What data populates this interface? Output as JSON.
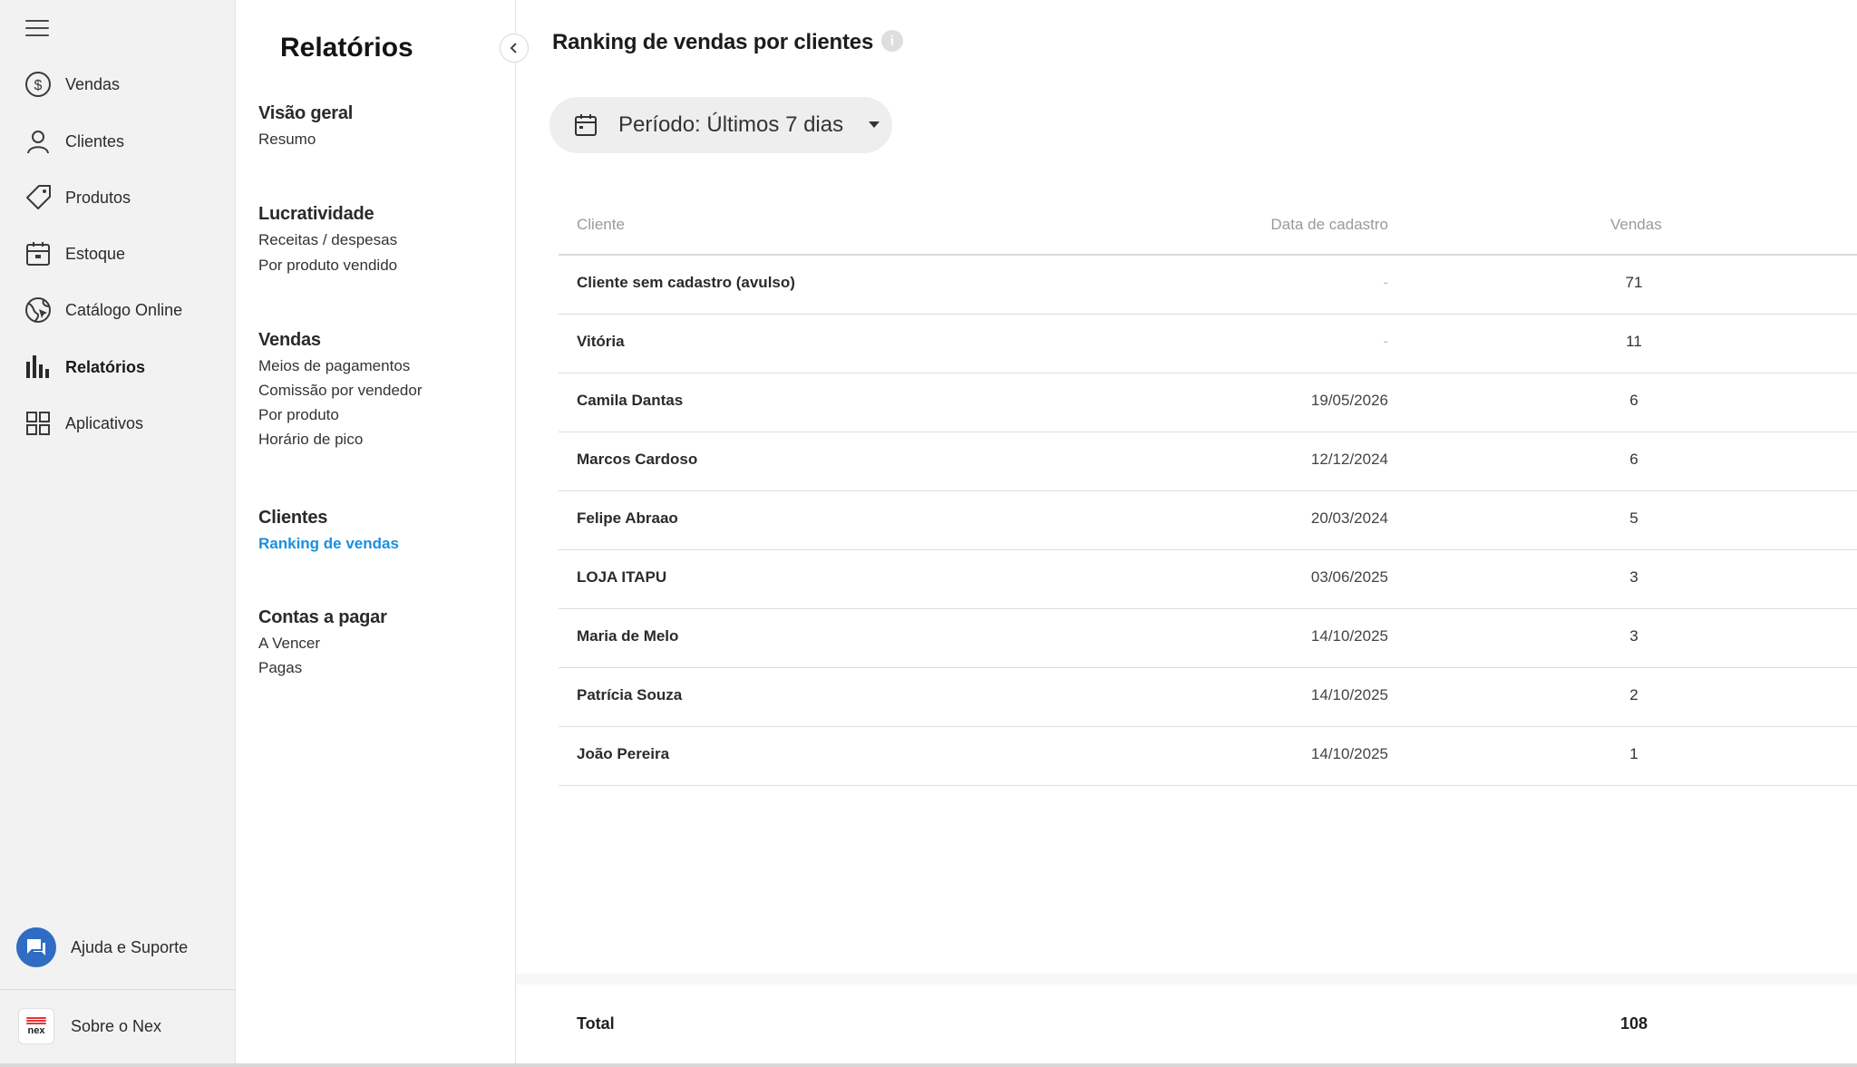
{
  "sidebar": {
    "items": [
      {
        "label": "Vendas",
        "icon": "dollar-circle-icon"
      },
      {
        "label": "Clientes",
        "icon": "person-icon"
      },
      {
        "label": "Produtos",
        "icon": "tag-icon"
      },
      {
        "label": "Estoque",
        "icon": "inventory-box-icon"
      },
      {
        "label": "Catálogo Online",
        "icon": "catalog-globe-icon"
      },
      {
        "label": "Relatórios",
        "icon": "bar-chart-icon",
        "active": true
      },
      {
        "label": "Aplicativos",
        "icon": "apps-grid-icon"
      }
    ],
    "help_label": "Ajuda e Suporte",
    "about_label": "Sobre o Nex",
    "about_logo_text": "nex"
  },
  "subpanel": {
    "title": "Relatórios",
    "groups": [
      {
        "heading": "Visão geral",
        "links": [
          "Resumo"
        ]
      },
      {
        "heading": "Lucratividade",
        "links": [
          "Receitas / despesas",
          "Por produto vendido"
        ]
      },
      {
        "heading": "Vendas",
        "links": [
          "Meios de pagamentos",
          "Comissão por vendedor",
          "Por produto",
          "Horário de pico"
        ]
      },
      {
        "heading": "Clientes",
        "links": [
          "Ranking de vendas"
        ],
        "active_link": "Ranking de vendas"
      },
      {
        "heading": "Contas a pagar",
        "links": [
          "A Vencer",
          "Pagas"
        ]
      }
    ]
  },
  "main": {
    "title": "Ranking de vendas por clientes",
    "info_glyph": "i",
    "period_label": "Período: Últimos 7 dias",
    "table": {
      "headers": {
        "client": "Cliente",
        "date": "Data de cadastro",
        "sales": "Vendas"
      },
      "rows": [
        {
          "client": "Cliente sem cadastro (avulso)",
          "date": "-",
          "sales": "71"
        },
        {
          "client": "Vitória",
          "date": "-",
          "sales": "11"
        },
        {
          "client": "Camila Dantas",
          "date": "19/05/2026",
          "sales": "6"
        },
        {
          "client": "Marcos Cardoso",
          "date": "12/12/2024",
          "sales": "6"
        },
        {
          "client": "Felipe Abraao",
          "date": "20/03/2024",
          "sales": "5"
        },
        {
          "client": "LOJA ITAPU",
          "date": "03/06/2025",
          "sales": "3"
        },
        {
          "client": "Maria de Melo",
          "date": "14/10/2025",
          "sales": "3"
        },
        {
          "client": "Patrícia Souza",
          "date": "14/10/2025",
          "sales": "2"
        },
        {
          "client": "João Pereira",
          "date": "14/10/2025",
          "sales": "1"
        }
      ]
    },
    "total_label": "Total",
    "total_value": "108"
  },
  "colors": {
    "sidebar_bg": "#f2f2f2",
    "active_link": "#1a8fe0",
    "help_bubble": "#2f6dc4",
    "logo_red": "#e8343a"
  }
}
